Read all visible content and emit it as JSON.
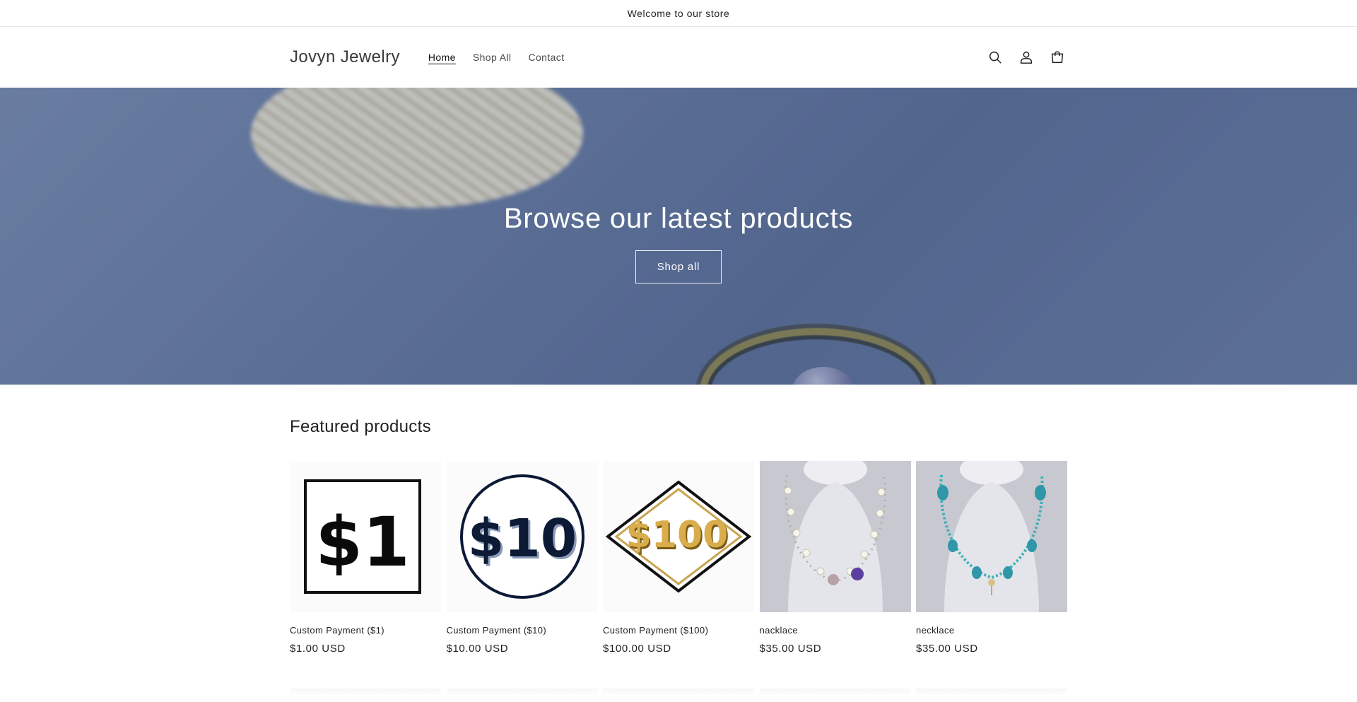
{
  "announcement": {
    "text": "Welcome to our store"
  },
  "header": {
    "logo": "Jovyn Jewelry",
    "nav": [
      {
        "label": "Home",
        "active": true
      },
      {
        "label": "Shop All",
        "active": false
      },
      {
        "label": "Contact",
        "active": false
      }
    ],
    "icons": [
      "search-icon",
      "account-icon",
      "cart-icon"
    ]
  },
  "hero": {
    "title": "Browse our latest products",
    "button": "Shop all"
  },
  "featured": {
    "title": "Featured products",
    "products": [
      {
        "title": "Custom Payment ($1)",
        "price": "$1.00 USD",
        "image_text": "$1",
        "image_type": "square"
      },
      {
        "title": "Custom Payment ($10)",
        "price": "$10.00 USD",
        "image_text": "$10",
        "image_type": "circle"
      },
      {
        "title": "Custom Payment ($100)",
        "price": "$100.00 USD",
        "image_text": "$100",
        "image_type": "diamond"
      },
      {
        "title": "nacklace",
        "price": "$35.00 USD",
        "image_type": "pearl-necklace"
      },
      {
        "title": "necklace",
        "price": "$35.00 USD",
        "image_type": "turquoise-necklace"
      }
    ]
  }
}
